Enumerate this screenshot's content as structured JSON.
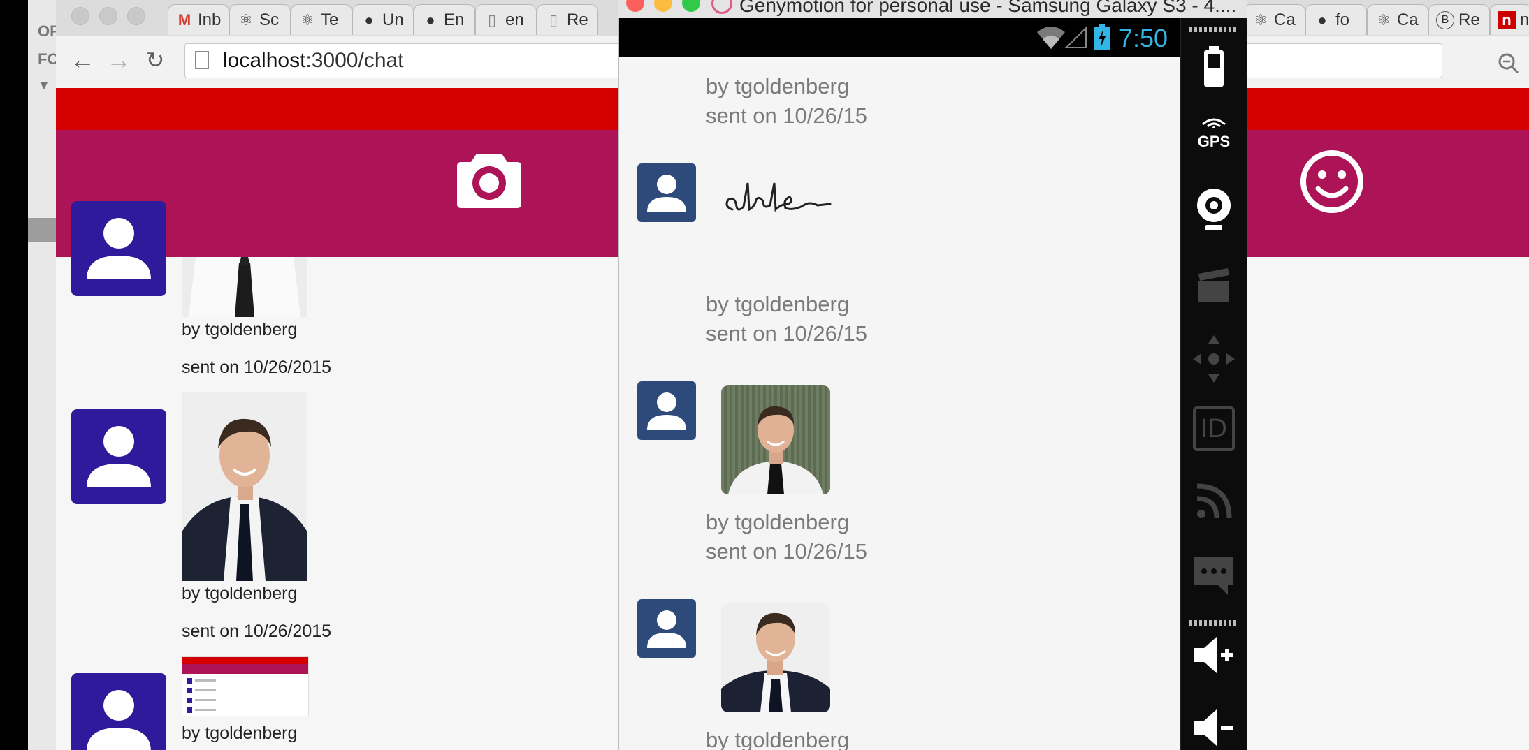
{
  "desktop": {
    "labels": [
      "OF",
      "FO",
      "▼"
    ]
  },
  "browser": {
    "tabs": [
      {
        "icon": "gmail-icon",
        "glyph": "M",
        "label": "Inb"
      },
      {
        "icon": "react-icon",
        "glyph": "⚛",
        "label": "Sc"
      },
      {
        "icon": "react-icon",
        "glyph": "⚛",
        "label": "Te"
      },
      {
        "icon": "github-icon",
        "glyph": "●",
        "label": "Un"
      },
      {
        "icon": "github-icon",
        "glyph": "●",
        "label": "En"
      },
      {
        "icon": "document-icon",
        "glyph": "▯",
        "label": "en"
      },
      {
        "icon": "document-icon",
        "glyph": "▯",
        "label": "Re"
      },
      {
        "icon": "react-icon",
        "glyph": "⚛",
        "label": "Ca"
      },
      {
        "icon": "github-icon",
        "glyph": "●",
        "label": "fo"
      },
      {
        "icon": "react-icon",
        "glyph": "⚛",
        "label": "Ca"
      },
      {
        "icon": "bootstrap-icon",
        "glyph": "B",
        "label": "Re"
      },
      {
        "icon": "npm-icon",
        "glyph": "n",
        "label": "n"
      }
    ],
    "url_host": "localhost",
    "url_rest": ":3000/chat",
    "colors": {
      "red_band": "#d50000",
      "header": "#ad1457",
      "avatar": "#2f1a9c"
    },
    "messages": [
      {
        "author": "by tgoldenberg",
        "date": "sent on 10/26/2015"
      },
      {
        "author": "by tgoldenberg",
        "date": "sent on 10/26/2015"
      },
      {
        "author": "by tgoldenberg"
      }
    ]
  },
  "emulator": {
    "title": "Genymotion for personal use - Samsung Galaxy S3 - 4....",
    "time": "7:50",
    "messages": [
      {
        "author": "by tgoldenberg",
        "date": "sent on 10/26/15"
      },
      {
        "author": "by tgoldenberg",
        "date": "sent on 10/26/15"
      },
      {
        "author": "by tgoldenberg",
        "date": "sent on 10/26/15"
      },
      {
        "author": "by tgoldenberg"
      }
    ],
    "sidebar": [
      "battery-icon",
      "gps-icon",
      "webcam-icon",
      "video-capture-icon",
      "dpad-icon",
      "device-id-icon",
      "network-icon",
      "sms-icon",
      "volume-up-icon",
      "volume-down-icon"
    ],
    "gps_label": "GPS",
    "id_label": "ID"
  }
}
